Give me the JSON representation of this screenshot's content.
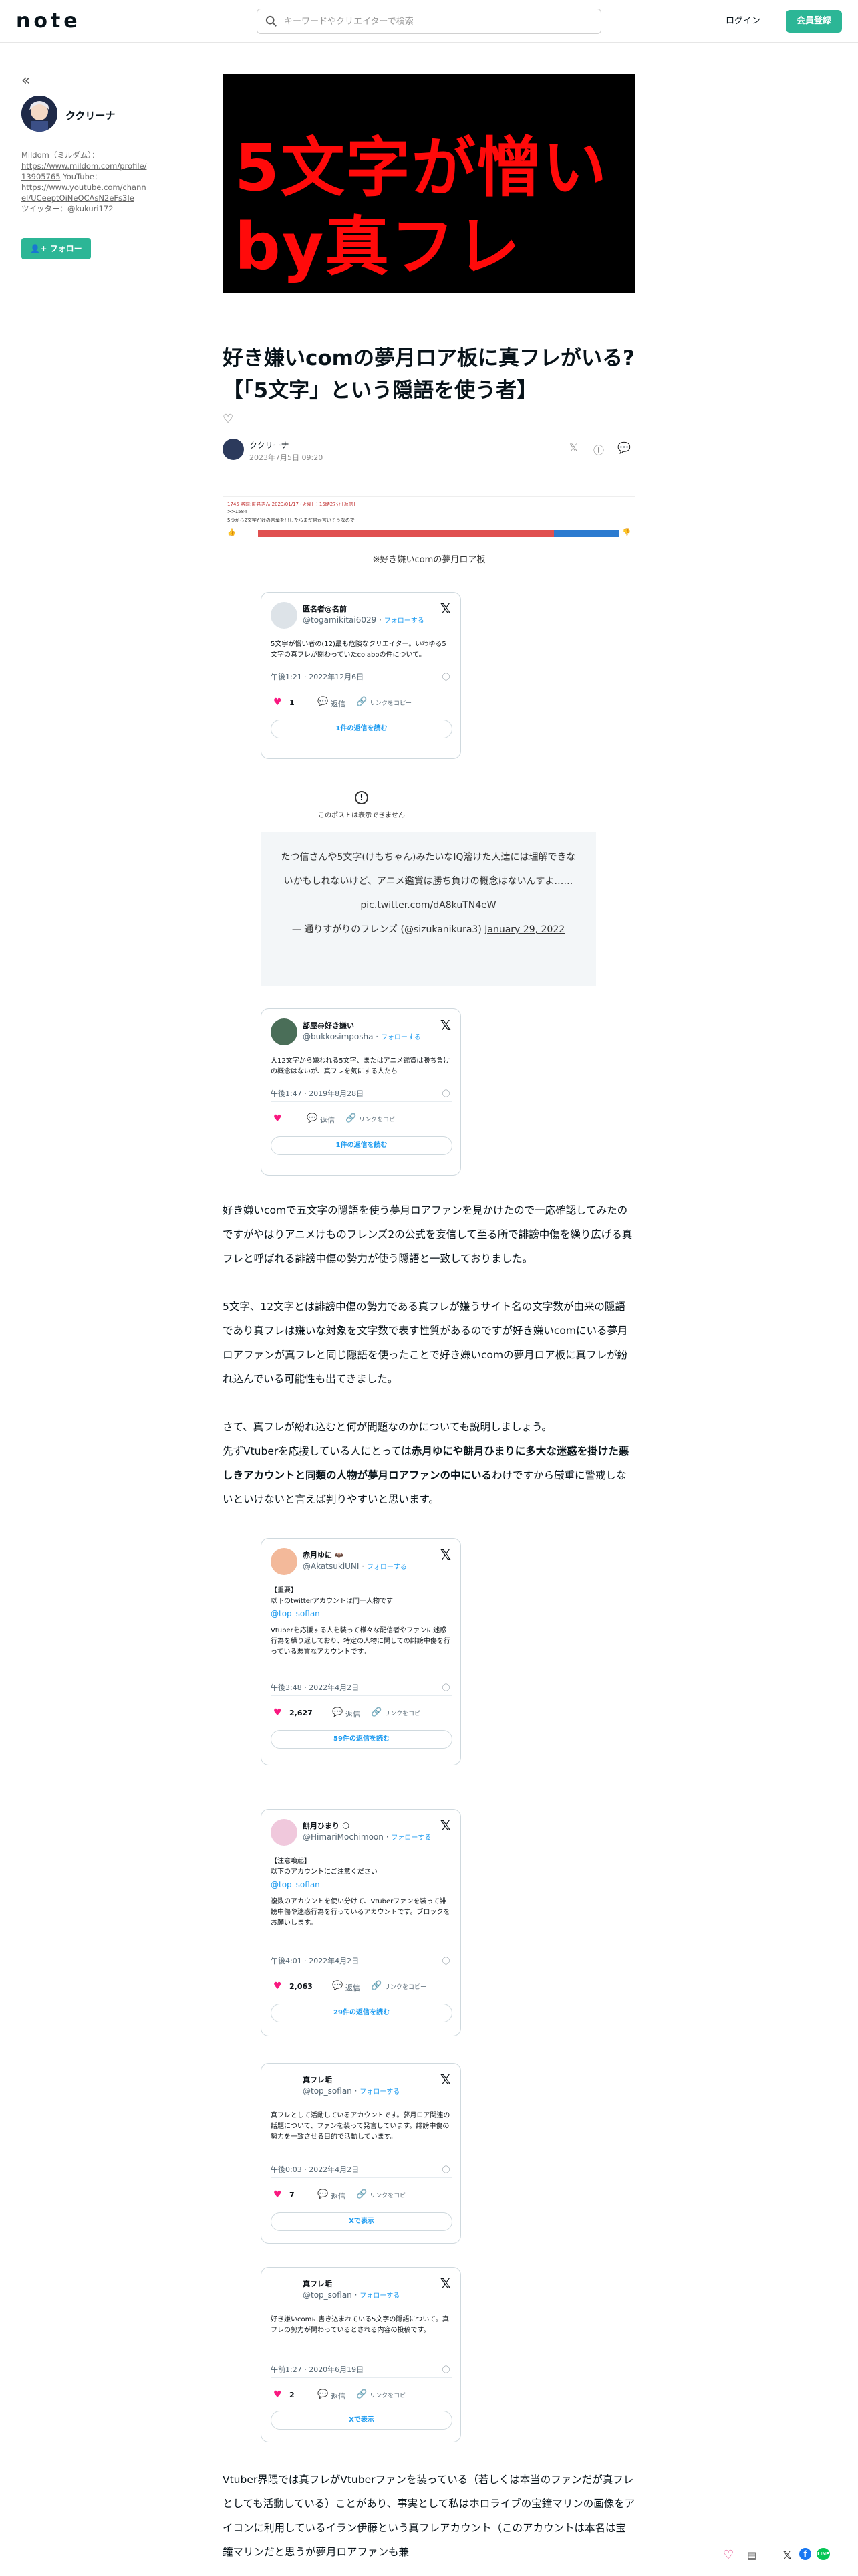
{
  "header": {
    "logo": "note",
    "search_placeholder": "キーワードやクリエイターで検索",
    "login_label": "ログイン",
    "signup_label": "会員登録"
  },
  "sidebar": {
    "author_name": "ククリーナ",
    "bio_line1": "Mildom（ミルダム）：",
    "bio_link1": "https://www.mildom.com/profile/13905765",
    "bio_line2": " YouTube：",
    "bio_link2": "https://www.youtube.com/channel/UCeeptOiNeQCAsN2eFs3Ie",
    "bio_line3": "ツイッター：@kukuri172",
    "follow_label": "フォロー"
  },
  "hero": {
    "line1": "5文字が憎い",
    "line2": "by真フレ"
  },
  "article": {
    "title": "好き嫌いcomの夢月ロア板に真フレがいる?【「5文字」という隠語を使う者】",
    "author": "ククリーナ",
    "date": "2023年7月5日 09:20",
    "image_caption": "※好き嫌いcomの夢月ロア板"
  },
  "poll_image": {
    "line1": "1745 名前:匿名さん 2023/01/17 (火曜日) 15時27分 [返信]",
    "line2": ">>1584",
    "line3": "5つから2文字だけの言葉を出したらまだ何か言いそうなので",
    "red_share": 0.82,
    "red_count": "0",
    "blue_count": "0"
  },
  "tweets": [
    {
      "name": "匿名者@名前",
      "handle": "@togamikitai6029",
      "follow": "フォローする",
      "body": "5文字が憎い者の(12)最も危険なクリエイター。いわゆる5文字の真フレが関わっていたcolaboの件について。",
      "time": "午後1:21 · 2022年12月6日",
      "likes": "1",
      "reply": "返信",
      "link": "リンクをコピー",
      "more": "1件の返信を読む"
    },
    {
      "name": "部屋@好き嫌い",
      "handle": "@bukkosimposha",
      "follow": "フォローする",
      "body": "大12文字から嫌われる5文字、またはアニメ鑑賞は勝ち負けの概念はないが、真フレを気にする人たち",
      "time": "午後1:47 · 2019年8月28日",
      "likes": "",
      "reply": "返信",
      "link": "リンクをコピー",
      "more": "1件の返信を読む"
    },
    {
      "name": "赤月ゆに 🦇",
      "handle": "@AkatsukiUNI",
      "follow": "フォローする",
      "body_a": "【重要】",
      "body_b": "以下のtwitterアカウントは同一人物です",
      "mention": "@top_soflan",
      "body_c": "Vtuberを応援する人を装って様々な配信者やファンに迷惑行為を繰り返しており、特定の人物に関しての誹謗中傷を行っている悪質なアカウントです。",
      "time": "午後3:48 · 2022年4月2日",
      "likes": "2,627",
      "reply": "返信",
      "link": "リンクをコピー",
      "more": "59件の返信を読む"
    },
    {
      "name": "餅月ひまり 🌕",
      "handle": "@HimariMochimoon",
      "follow": "フォローする",
      "body_a": "【注意喚起】",
      "body_b": "以下のアカウントにご注意ください",
      "mention": "@top_soflan",
      "body_c": "複数のアカウントを使い分けて、Vtuberファンを装って誹謗中傷や迷惑行為を行っているアカウントです。ブロックをお願いします。",
      "time": "午後4:01 · 2022年4月2日",
      "likes": "2,063",
      "reply": "返信",
      "link": "リンクをコピー",
      "more": "29件の返信を読む"
    },
    {
      "name": "真フレ垢",
      "handle": "@top_soflan",
      "follow": "フォローする",
      "body": "真フレとして活動しているアカウントです。夢月ロア関連の話題について、ファンを装って発言しています。誹謗中傷の勢力を一致させる目的で活動しています。",
      "time": "午後0:03 · 2022年4月2日",
      "likes": "7",
      "reply": "返信",
      "link": "リンクをコピー",
      "more": "Xで表示"
    },
    {
      "name": "真フレ垢",
      "handle": "@top_soflan",
      "follow": "フォローする",
      "body": "好き嫌いcomに書き込まれている5文字の隠語について。真フレの勢力が関わっているとされる内容の投稿です。",
      "time": "午前1:27 · 2020年6月19日",
      "likes": "2",
      "reply": "返信",
      "link": "リンクをコピー",
      "more": "Xで表示"
    }
  ],
  "unavailable_text": "このポストは表示できません",
  "quote": {
    "text": "たつ信さんや5文字(けもちゃん)みたいなIQ溶けた人達には理解できないかもしれないけど、アニメ鑑賞は勝ち負けの概念はないんすよ……",
    "link": "pic.twitter.com/dA8kuTN4eW",
    "attribution": "— 通りすがりのフレンズ (@sizukanikura3)",
    "date": "January 29, 2022"
  },
  "paragraphs": {
    "p1": "好き嫌いcomで五文字の隠語を使う夢月ロアファンを見かけたので一応確認してみたのですがやはりアニメけものフレンズ2の公式を妄信して至る所で誹謗中傷を繰り広げる真フレと呼ばれる誹謗中傷の勢力が使う隠語と一致しておりました。",
    "p2": "5文字、12文字とは誹謗中傷の勢力である真フレが嫌うサイト名の文字数が由来の隠語であり真フレは嫌いな対象を文字数で表す性質があるのですが好き嫌いcomにいる夢月ロアファンが真フレと同じ隠語を使ったことで好き嫌いcomの夢月ロア板に真フレが紛れ込んでいる可能性も出てきました。",
    "p3": "さて、真フレが紛れ込むと何が問題なのかについても説明しましょう。",
    "p4a": "先ずVtuberを応援している人にとっては",
    "p4b": "赤月ゆにや餅月ひまりに多大な迷惑を掛けた悪しきアカウントと同類の人物が夢月ロアファンの中にいる",
    "p4c": "わけですから厳重に警戒しないといけないと言えば判りやすいと思います。",
    "p5": "Vtuber界隈では真フレがVtuberファンを装っている（若しくは本当のファンだが真フレとしても活動している）ことがあり、事実として私はホロライブの宝鐘マリンの画像をアイコンに利用しているイラン伊藤という真フレアカウント（このアカウントは本名は宝鐘マリンだと思うが夢月ロアファンも兼"
  },
  "colors": {
    "brand": "#2cb696",
    "hero_text": "#ff0a0a",
    "twitter_blue": "#1d9bf0",
    "like_pink": "#f91880"
  }
}
